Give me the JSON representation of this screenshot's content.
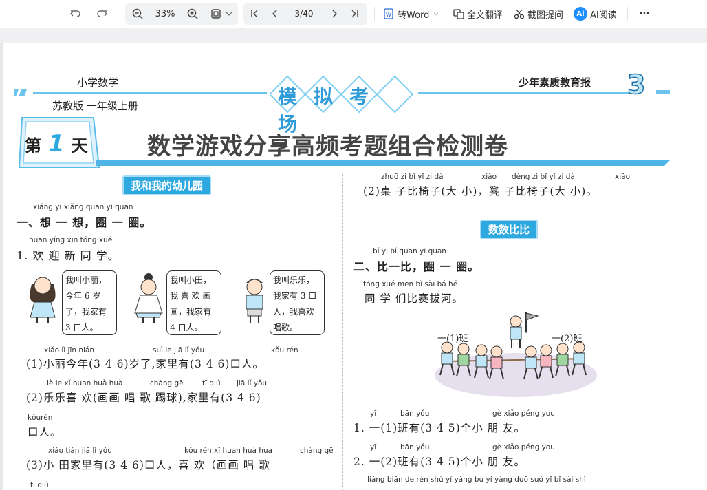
{
  "toolbar": {
    "zoom": "33%",
    "page": "3/40",
    "to_word": "转Word",
    "translate": "全文翻译",
    "screenshot_ask": "截图提问",
    "ai_read": "AI阅读",
    "ai_badge": "Ai",
    "more": "···"
  },
  "header": {
    "subject": "小学数学",
    "edition": "苏教版  一年级上册",
    "banner": "模拟考场",
    "newspaper": "少年素质教育报",
    "issue_number": "3",
    "day_label_pre": "第",
    "day_label_num": "1",
    "day_label_post": "天",
    "title": "数学游戏分享高频考题组合检测卷"
  },
  "left": {
    "section1_pill": "我和我的幼儿园",
    "q1_pinyin": "xiǎng yi xiǎng  quān yi quān",
    "q1": "一、想 一 想，圈 一 圈。",
    "item1_pinyin": "huān yíng xīn tóng xué",
    "item1": "1. 欢 迎 新 同 学。",
    "bubble1": "我叫小丽，今年 6 岁了，我家有 3 口人。",
    "bubble2": "我叫小田，我 喜 欢 画 画，我家有 4 口人。",
    "bubble3": "我叫乐乐，我家有 3 口人，我喜欢唱歌。",
    "l1_pinyin_a": "xiǎo   lì   jīn  nián",
    "l1_pinyin_b": "suì  le    jiā   lǐ  yǒu",
    "l1_pinyin_c": "kǒu rén",
    "l1": "(1)小丽今年(3   4   6)岁了,家里有(3   4   6)口人。",
    "l2_pinyin_a": "lè   le   xǐ  huan  huà huà",
    "l2_pinyin_b": "chàng gē",
    "l2_pinyin_c": "tī  qiú",
    "l2_pinyin_d": "jiā  lǐ  yǒu",
    "l2": "(2)乐乐喜 欢(画画     唱 歌     踢球),家里有(3    4    6)",
    "l3_pinyin": "kǒurén",
    "l3": "口人。",
    "l4_pinyin_a": "xiǎo tián jiā   lǐ  yǒu",
    "l4_pinyin_b": "kǒu rén    xǐ  huan   huà huà",
    "l4_pinyin_c": "chàng gē",
    "l4": "(3)小 田家里有(3    4    6)口人，喜 欢（画画      唱 歌",
    "l5_pinyin": "tī  qiú"
  },
  "right": {
    "r0_pinyin_a": "zhuō  zi   bǐ   yǐ   zi     dà",
    "r0_pinyin_b": "xiǎo",
    "r0_pinyin_c": "dèng  zi   bǐ   yǐ   zi    dà",
    "r0_pinyin_d": "xiǎo",
    "r0": "(2)桌 子比椅子(大    小)，凳 子比椅子(大    小)。",
    "section2_pill": "数数比比",
    "q2_pinyin": "bǐ  yi  bǐ   quān yi quān",
    "q2": "二、比一比，圈 一 圈。",
    "intro_pinyin": "tóng xué men  bǐ  sài  bá  hé",
    "intro": "同 学 们比赛拔河。",
    "class1": "一(1)班",
    "class2": "一(2)班",
    "i1_pinyin_a": "yī",
    "i1_pinyin_b": "bān yǒu",
    "i1_pinyin_c": "gè xiǎo péng you",
    "i1": "1. 一(1)班有(3    4    5)个小 朋 友。",
    "i2_pinyin_a": "yī",
    "i2_pinyin_b": "bān yǒu",
    "i2_pinyin_c": "gè xiǎo péng you",
    "i2": "2. 一(2)班有(3    4    5)个小 朋 友。",
    "i3_pinyin": "liǎng biān  de  rén  shù    yí  yàng        bù  yí  yàng   duō    suǒ  yǐ      bǐ  sài shì"
  }
}
